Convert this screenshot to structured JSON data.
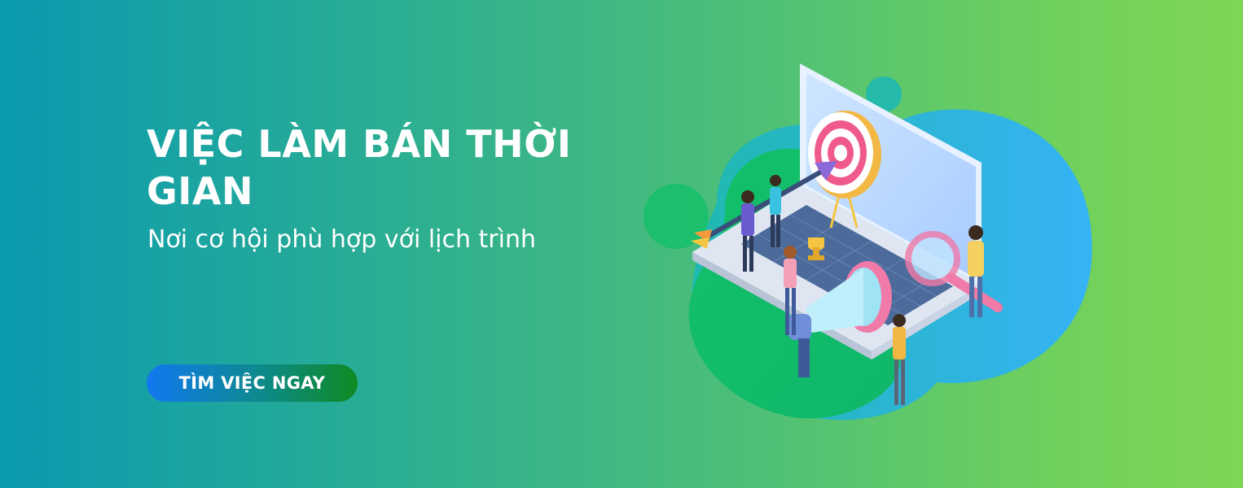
{
  "hero": {
    "headline": "VIỆC LÀM BÁN THỜI GIAN",
    "subtitle": "Nơi cơ hội phù hợp với lịch trình",
    "cta_label": "TÌM VIỆC NGAY"
  },
  "illustration": {
    "icons": [
      "laptop-icon",
      "target-icon",
      "arrow-icon",
      "megaphone-icon",
      "magnifier-icon",
      "trophy-icon",
      "people-icon"
    ]
  },
  "colors": {
    "gradient_start": "#0a9ab0",
    "gradient_end": "#7fd656",
    "cta_start": "#1178f0",
    "cta_end": "#0e8a22",
    "text": "#ffffff"
  }
}
